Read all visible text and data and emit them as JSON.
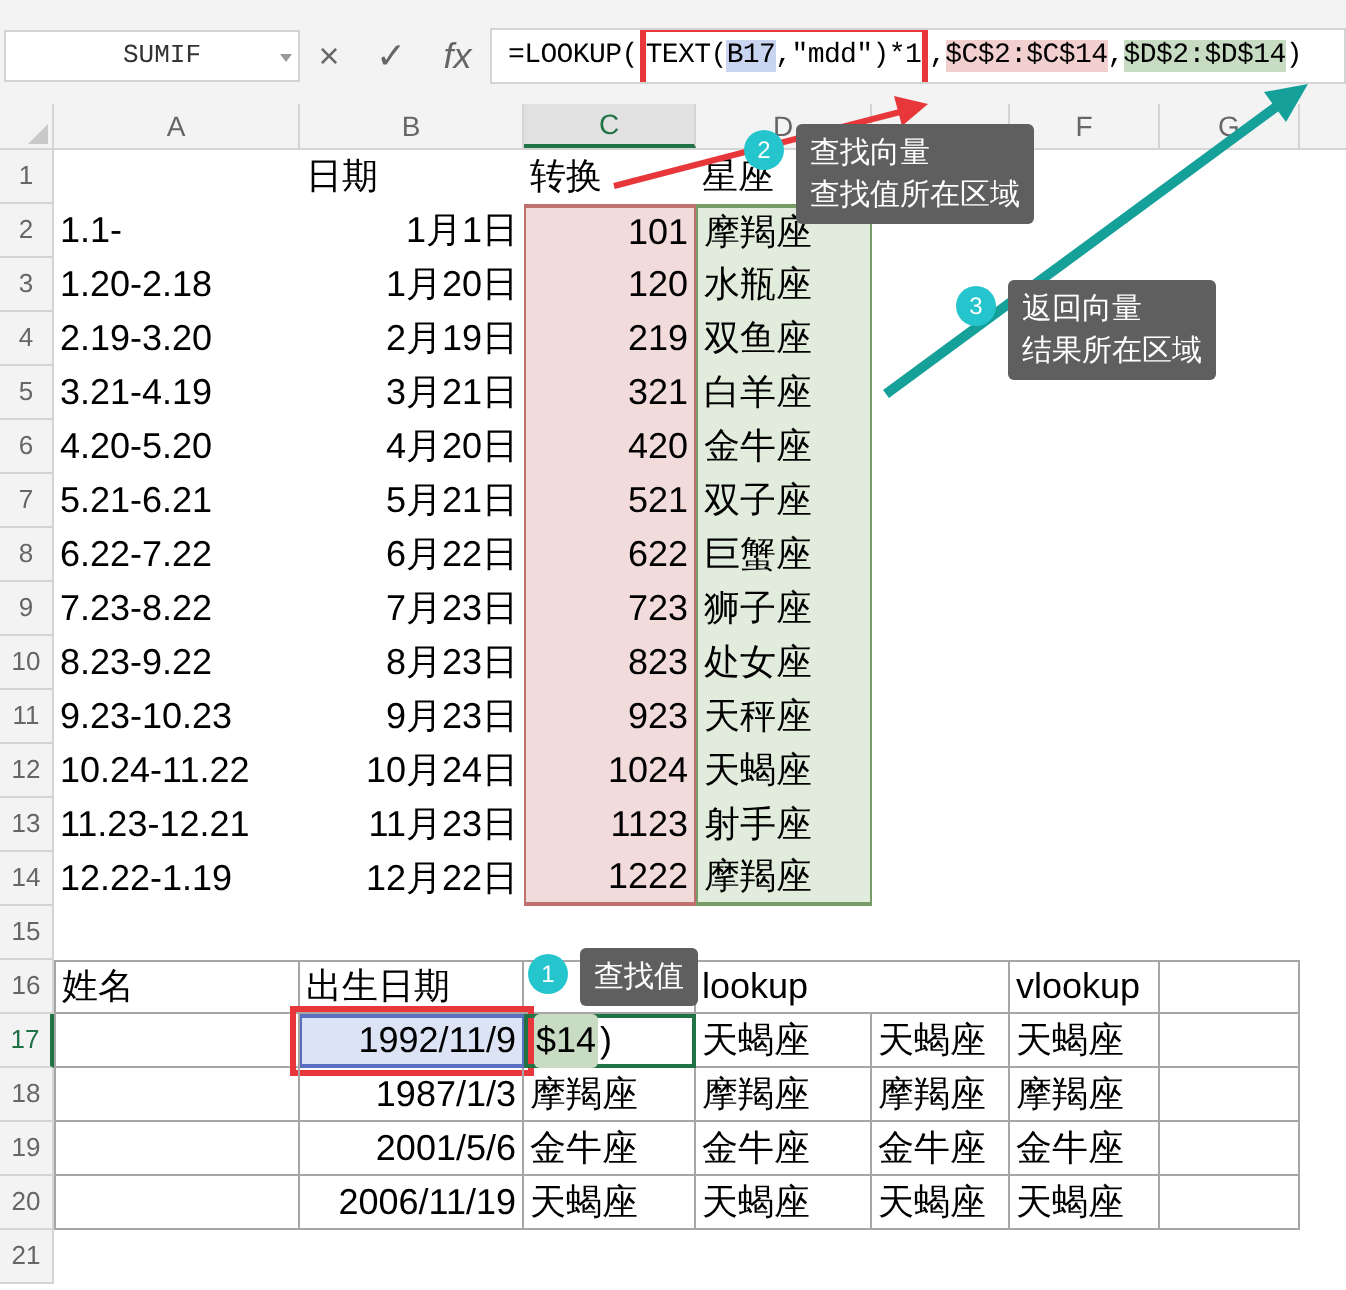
{
  "name_box": "SUMIF",
  "formula_buttons": [
    "×",
    "✓",
    "fx"
  ],
  "formula": [
    {
      "text": "=LOOKUP(",
      "kind": "plain"
    },
    {
      "text": "TEXT(",
      "kind": "plain",
      "framed": true
    },
    {
      "text": "B17",
      "kind": "ref_b",
      "framed": true
    },
    {
      "text": ",\"mdd\")*1",
      "kind": "plain",
      "framed": true
    },
    {
      "text": ",",
      "kind": "plain"
    },
    {
      "text": "$C$2:$C$14",
      "kind": "ref_c"
    },
    {
      "text": ",",
      "kind": "plain"
    },
    {
      "text": "$D$2:$D$14",
      "kind": "ref_d"
    },
    {
      "text": ")",
      "kind": "plain"
    }
  ],
  "columns": [
    {
      "label": "A",
      "selected": false
    },
    {
      "label": "B",
      "selected": false
    },
    {
      "label": "C",
      "selected": true
    },
    {
      "label": "D",
      "selected": false
    },
    {
      "selected": false
    },
    {
      "label": "F",
      "selected": false
    },
    {
      "label": "G",
      "selected": false
    }
  ],
  "rows": [
    {
      "number": "1",
      "selected": false,
      "cells": [
        {
          "kind": "empty"
        },
        {
          "kind": "text",
          "text": "日期"
        },
        {
          "kind": "text",
          "text": "转换"
        },
        {
          "kind": "text",
          "text": "星座"
        }
      ]
    },
    {
      "number": "2",
      "selected": false,
      "cells": [
        {
          "kind": "text",
          "text": "1.1-"
        },
        {
          "kind": "number",
          "text": "1月1日"
        },
        {
          "kind": "number",
          "text": "101",
          "color": "#f2dcdb"
        },
        {
          "kind": "text",
          "text": "摩羯座",
          "color": "#e2ecdc"
        }
      ]
    },
    {
      "number": "3",
      "selected": false,
      "cells": [
        {
          "kind": "text",
          "text": "1.20-2.18"
        },
        {
          "kind": "number",
          "text": "1月20日"
        },
        {
          "kind": "number",
          "text": "120",
          "color": "#f2dcdb"
        },
        {
          "kind": "text",
          "text": "水瓶座",
          "color": "#e2ecdc"
        }
      ]
    },
    {
      "number": "4",
      "selected": false,
      "cells": [
        {
          "kind": "text",
          "text": "2.19-3.20"
        },
        {
          "kind": "number",
          "text": "2月19日"
        },
        {
          "kind": "number",
          "text": "219",
          "color": "#f2dcdb"
        },
        {
          "kind": "text",
          "text": "双鱼座",
          "color": "#e2ecdc"
        }
      ]
    },
    {
      "number": "5",
      "selected": false,
      "cells": [
        {
          "kind": "text",
          "text": "3.21-4.19"
        },
        {
          "kind": "number",
          "text": "3月21日"
        },
        {
          "kind": "number",
          "text": "321",
          "color": "#f2dcdb"
        },
        {
          "kind": "text",
          "text": "白羊座",
          "color": "#e2ecdc"
        }
      ]
    },
    {
      "number": "6",
      "selected": false,
      "cells": [
        {
          "kind": "text",
          "text": "4.20-5.20"
        },
        {
          "kind": "number",
          "text": "4月20日"
        },
        {
          "kind": "number",
          "text": "420",
          "color": "#f2dcdb"
        },
        {
          "kind": "text",
          "text": "金牛座",
          "color": "#e2ecdc"
        }
      ]
    },
    {
      "number": "7",
      "selected": false,
      "cells": [
        {
          "kind": "text",
          "text": "5.21-6.21"
        },
        {
          "kind": "number",
          "text": "5月21日"
        },
        {
          "kind": "number",
          "text": "521",
          "color": "#f2dcdb"
        },
        {
          "kind": "text",
          "text": "双子座",
          "color": "#e2ecdc"
        }
      ]
    },
    {
      "number": "8",
      "selected": false,
      "cells": [
        {
          "kind": "text",
          "text": "6.22-7.22"
        },
        {
          "kind": "number",
          "text": "6月22日"
        },
        {
          "kind": "number",
          "text": "622",
          "color": "#f2dcdb"
        },
        {
          "kind": "text",
          "text": "巨蟹座",
          "color": "#e2ecdc"
        }
      ]
    },
    {
      "number": "9",
      "selected": false,
      "cells": [
        {
          "kind": "text",
          "text": "7.23-8.22"
        },
        {
          "kind": "number",
          "text": "7月23日"
        },
        {
          "kind": "number",
          "text": "723",
          "color": "#f2dcdb"
        },
        {
          "kind": "text",
          "text": "狮子座",
          "color": "#e2ecdc"
        }
      ]
    },
    {
      "number": "10",
      "selected": false,
      "cells": [
        {
          "kind": "text",
          "text": "8.23-9.22"
        },
        {
          "kind": "number",
          "text": "8月23日"
        },
        {
          "kind": "number",
          "text": "823",
          "color": "#f2dcdb"
        },
        {
          "kind": "text",
          "text": "处女座",
          "color": "#e2ecdc"
        }
      ]
    },
    {
      "number": "11",
      "selected": false,
      "cells": [
        {
          "kind": "text",
          "text": "9.23-10.23"
        },
        {
          "kind": "number",
          "text": "9月23日"
        },
        {
          "kind": "number",
          "text": "923",
          "color": "#f2dcdb"
        },
        {
          "kind": "text",
          "text": "天秤座",
          "color": "#e2ecdc"
        }
      ]
    },
    {
      "number": "12",
      "selected": false,
      "cells": [
        {
          "kind": "text",
          "text": "10.24-11.22"
        },
        {
          "kind": "number",
          "text": "10月24日"
        },
        {
          "kind": "number",
          "text": "1024",
          "color": "#f2dcdb"
        },
        {
          "kind": "text",
          "text": "天蝎座",
          "color": "#e2ecdc"
        }
      ]
    },
    {
      "number": "13",
      "selected": false,
      "cells": [
        {
          "kind": "text",
          "text": "11.23-12.21"
        },
        {
          "kind": "number",
          "text": "11月23日"
        },
        {
          "kind": "number",
          "text": "1123",
          "color": "#f2dcdb"
        },
        {
          "kind": "text",
          "text": "射手座",
          "color": "#e2ecdc"
        }
      ]
    },
    {
      "number": "14",
      "selected": false,
      "cells": [
        {
          "kind": "text",
          "text": "12.22-1.19"
        },
        {
          "kind": "number",
          "text": "12月22日"
        },
        {
          "kind": "number",
          "text": "1222",
          "color": "#f2dcdb"
        },
        {
          "kind": "text",
          "text": "摩羯座",
          "color": "#e2ecdc"
        }
      ]
    },
    {
      "number": "15",
      "selected": false,
      "cells": []
    },
    {
      "number": "16",
      "selected": false,
      "bordered": true,
      "cells": [
        {
          "kind": "text",
          "text": "姓名"
        },
        {
          "kind": "text",
          "text": "出生日期"
        },
        {
          "kind": "empty"
        },
        {
          "kind": "text",
          "text": "lookup",
          "merged": true
        },
        {
          "kind": "text",
          "text": "vlookup"
        },
        {
          "kind": "empty"
        }
      ]
    },
    {
      "number": "17",
      "selected": true,
      "bordered": true,
      "cells": [
        {
          "kind": "empty"
        },
        {
          "kind": "number",
          "text": "1992/11/9",
          "color": "#dbe3f5",
          "framed": true
        },
        {
          "kind": "editing",
          "active": true,
          "segments": [
            {
              "text": "$14",
              "kind": "ref_d"
            },
            {
              "text": ")",
              "kind": "plain"
            }
          ]
        },
        {
          "kind": "text",
          "text": "天蝎座"
        },
        {
          "kind": "text",
          "text": "天蝎座"
        },
        {
          "kind": "text",
          "text": "天蝎座"
        },
        {
          "kind": "empty"
        }
      ]
    },
    {
      "number": "18",
      "selected": false,
      "bordered": true,
      "cells": [
        {
          "kind": "empty"
        },
        {
          "kind": "number",
          "text": "1987/1/3"
        },
        {
          "kind": "text",
          "text": "摩羯座"
        },
        {
          "kind": "text",
          "text": "摩羯座"
        },
        {
          "kind": "text",
          "text": "摩羯座"
        },
        {
          "kind": "text",
          "text": "摩羯座"
        },
        {
          "kind": "empty"
        }
      ]
    },
    {
      "number": "19",
      "selected": false,
      "bordered": true,
      "cells": [
        {
          "kind": "empty"
        },
        {
          "kind": "number",
          "text": "2001/5/6"
        },
        {
          "kind": "text",
          "text": "金牛座"
        },
        {
          "kind": "text",
          "text": "金牛座"
        },
        {
          "kind": "text",
          "text": "金牛座"
        },
        {
          "kind": "text",
          "text": "金牛座"
        },
        {
          "kind": "empty"
        }
      ]
    },
    {
      "number": "20",
      "selected": false,
      "bordered": true,
      "cells": [
        {
          "kind": "empty"
        },
        {
          "kind": "number",
          "text": "2006/11/19"
        },
        {
          "kind": "text",
          "text": "天蝎座"
        },
        {
          "kind": "text",
          "text": "天蝎座"
        },
        {
          "kind": "text",
          "text": "天蝎座"
        },
        {
          "kind": "text",
          "text": "天蝎座"
        },
        {
          "kind": "empty"
        }
      ]
    },
    {
      "number": "21",
      "selected": false,
      "cells": []
    }
  ],
  "callouts": [
    {
      "number": "1",
      "lines": [
        "查找值"
      ]
    },
    {
      "number": "2",
      "lines": [
        "查找向量",
        "查找值所在区域"
      ]
    },
    {
      "number": "3",
      "lines": [
        "返回向量",
        "结果所在区域"
      ]
    }
  ]
}
